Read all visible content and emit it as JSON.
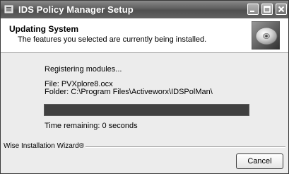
{
  "window": {
    "title": "IDS Policy Manager Setup",
    "icon": "installer-icon",
    "controls": [
      "minimize-icon",
      "maximize-icon",
      "close-icon"
    ]
  },
  "header": {
    "title": "Updating System",
    "subtitle": "The features you selected are currently being installed.",
    "icon": "cd-disc-icon"
  },
  "status": {
    "action": "Registering modules...",
    "file": "File: PVXplore8.ocx",
    "folder": "Folder: C:\\Program Files\\Activeworx\\IDSPolMan\\",
    "progress_fraction": 1.0,
    "time_remaining": "Time remaining: 0 seconds"
  },
  "footer": {
    "wizard_label": "Wise Installation Wizard®",
    "cancel_label": "Cancel"
  }
}
